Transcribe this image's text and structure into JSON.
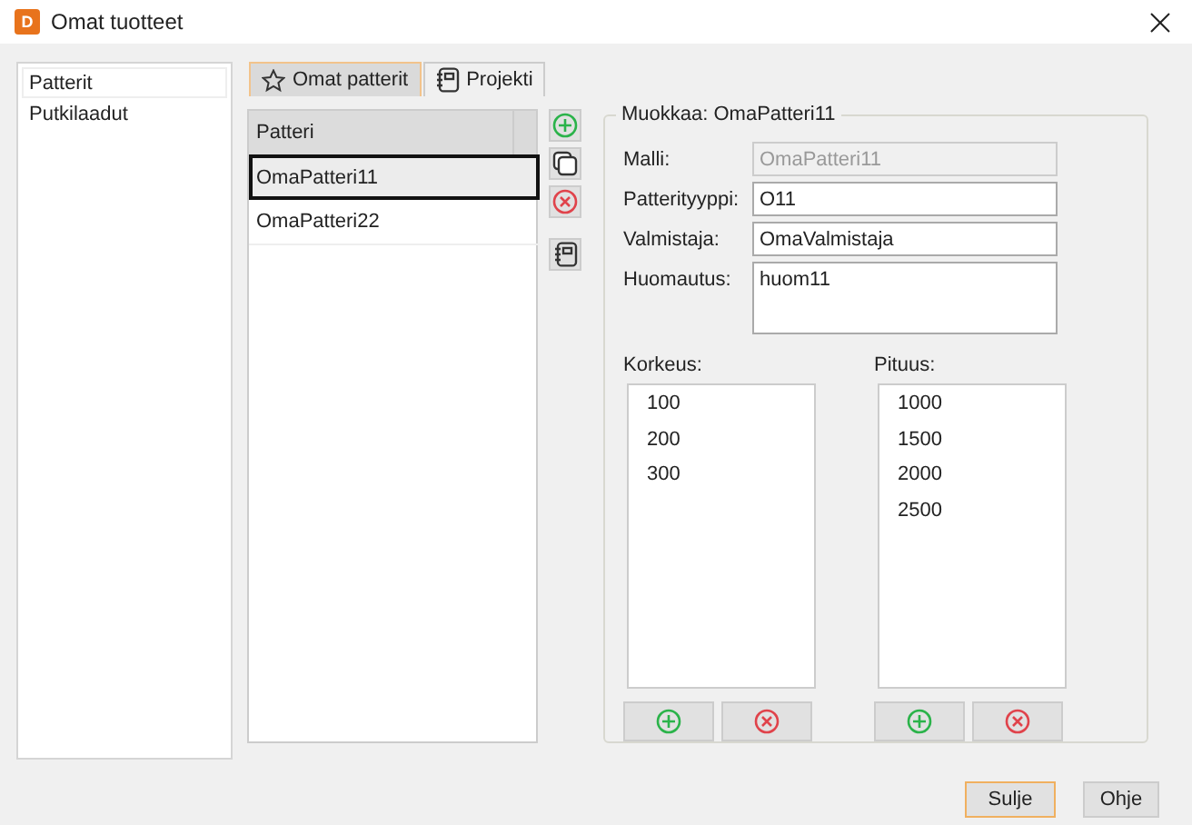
{
  "window": {
    "title": "Omat tuotteet",
    "logo": "D"
  },
  "sidebar": {
    "items": [
      {
        "label": "Patterit",
        "selected": true
      },
      {
        "label": "Putkilaadut",
        "selected": false
      }
    ]
  },
  "tabs": [
    {
      "label": "Omat patterit",
      "selected": true
    },
    {
      "label": "Projekti",
      "selected": false
    }
  ],
  "table": {
    "columns": [
      "Patteri"
    ],
    "rows": [
      {
        "cells": [
          "OmaPatteri11"
        ],
        "selected": true
      },
      {
        "cells": [
          "OmaPatteri22"
        ],
        "selected": false
      }
    ]
  },
  "editor": {
    "title": "Muokkaa: OmaPatteri11",
    "fields": [
      {
        "label": "Malli:",
        "value": "OmaPatteri11",
        "disabled": true,
        "kind": "line"
      },
      {
        "label": "Patterityyppi:",
        "value": "O11",
        "disabled": false,
        "kind": "line"
      },
      {
        "label": "Valmistaja:",
        "value": "OmaValmistaja",
        "disabled": false,
        "kind": "line"
      },
      {
        "label": "Huomautus:",
        "value": "huom11",
        "disabled": false,
        "kind": "area"
      }
    ]
  },
  "lists": [
    {
      "label": "Korkeus:",
      "items": [
        "100",
        "200",
        "300"
      ]
    },
    {
      "label": "Pituus:",
      "items": [
        "1000",
        "1500",
        "2000",
        "2500"
      ]
    }
  ],
  "buttons": [
    {
      "label": "Sulje",
      "focused": true
    },
    {
      "label": "Ohje",
      "focused": false
    }
  ]
}
